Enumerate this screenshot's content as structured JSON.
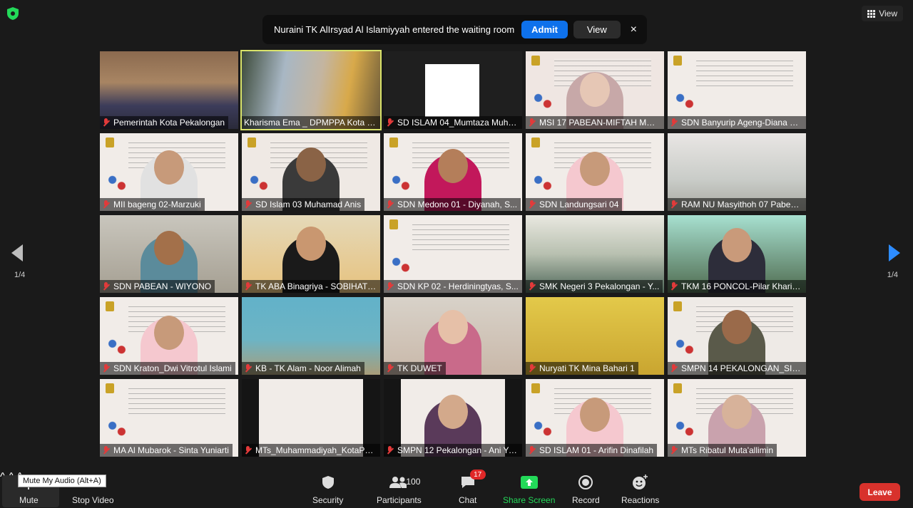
{
  "notification": {
    "message": "Nuraini TK AlIrsyad  Al Islamiyyah entered the waiting room",
    "admit_label": "Admit",
    "view_label": "View",
    "close_icon": "×"
  },
  "view_button": {
    "label": "View"
  },
  "pagination": {
    "left": "1/4",
    "right": "1/4"
  },
  "tiles": [
    {
      "name": "Pemerintah Kota Pekalongan",
      "bg": "room",
      "muted": true
    },
    {
      "name": "Kharisma Ema _ DPMPPA Kota P...",
      "bg": "blur",
      "muted": false,
      "active": true
    },
    {
      "name": "SD ISLAM 04_Mumtaza Muhaj...",
      "bg": "dark-white",
      "muted": true
    },
    {
      "name": "MSI 17 PABEAN-MIFTAH MUC...",
      "bg": "slide-people",
      "muted": true
    },
    {
      "name": "SDN Banyurip Ageng-Diana K...",
      "bg": "slide",
      "muted": true
    },
    {
      "name": "MII bageng 02-Marzuki",
      "bg": "slide-man",
      "muted": true
    },
    {
      "name": "SD Islam 03 Muhamad Anis",
      "bg": "slide-man2",
      "muted": true
    },
    {
      "name": "SDN Medono 01 - Diyanah, S...",
      "bg": "slide-woman-pink",
      "muted": true
    },
    {
      "name": "SDN Landungsari 04",
      "bg": "slide-woman-mask",
      "muted": true
    },
    {
      "name": "RAM NU Masyithoh 07 Pabea...",
      "bg": "slide-faded",
      "muted": true
    },
    {
      "name": "SDN PABEAN - WIYONO",
      "bg": "man-room",
      "muted": true
    },
    {
      "name": "TK ABA Binagriya - SOBIHATI, ...",
      "bg": "hijab-black",
      "muted": true
    },
    {
      "name": "SDN KP 02 - Herdiningtyas, S...",
      "bg": "slide",
      "muted": true
    },
    {
      "name": "SMK Negeri 3 Pekalongan - Y...",
      "bg": "classroom",
      "muted": true
    },
    {
      "name": "TKM 16 PONCOL-Pilar Kharis...",
      "bg": "green-hijab",
      "muted": true
    },
    {
      "name": "SDN Kraton_Dwi Vitrotul Islami",
      "bg": "slide-woman-mask",
      "muted": true
    },
    {
      "name": "KB - TK Alam - Noor Alimah",
      "bg": "blue-wall",
      "muted": true
    },
    {
      "name": "TK DUWET",
      "bg": "pink-hijab",
      "muted": true
    },
    {
      "name": "Nuryati TK Mina Bahari 1",
      "bg": "yellow-room",
      "muted": true
    },
    {
      "name": "SMPN 14 PEKALONGAN_SITI ...",
      "bg": "slide-man3",
      "muted": true
    },
    {
      "name": "MA Al Mubarok - Sinta Yuniarti",
      "bg": "slide",
      "muted": true
    },
    {
      "name": "MTs_Muhammadiyah_KotaPek...",
      "bg": "dark-slide",
      "muted": true
    },
    {
      "name": "SMPN 12 Pekalongan - Ani Yu...",
      "bg": "dark-slide-woman",
      "muted": true
    },
    {
      "name": "SD ISLAM 01 - Arifin Dinafilah",
      "bg": "slide-woman-mask",
      "muted": true
    },
    {
      "name": "MTs Ribatul Muta'allimin",
      "bg": "slide-woman-hijab",
      "muted": true
    }
  ],
  "toolbar": {
    "mute": "Mute",
    "mute_tooltip": "Mute My Audio (Alt+A)",
    "stop_video": "Stop Video",
    "security": "Security",
    "participants": "Participants",
    "participants_count": "100",
    "chat": "Chat",
    "chat_badge": "17",
    "share_screen": "Share Screen",
    "record": "Record",
    "reactions": "Reactions",
    "leave": "Leave"
  },
  "colors": {
    "accent_blue": "#0e71eb",
    "share_green": "#23d959",
    "leave_red": "#d8322c",
    "active_speaker": "#d9e36a"
  }
}
